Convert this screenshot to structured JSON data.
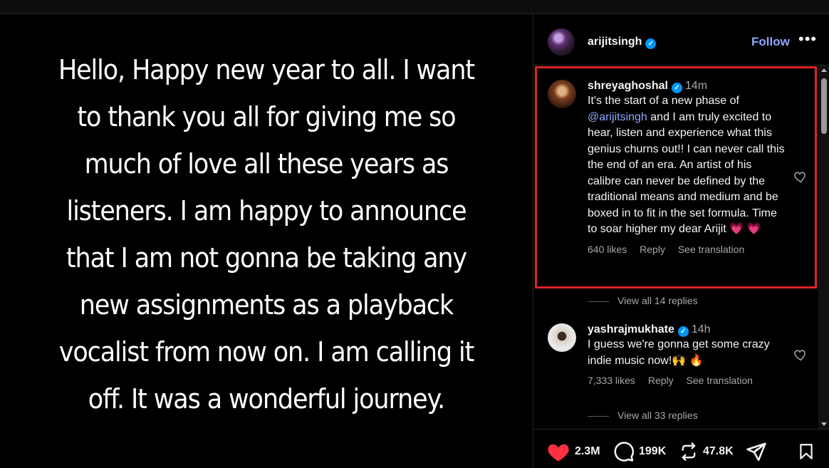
{
  "post": {
    "text": "Hello, Happy new year to all. I want to thank you all for giving me so much of love all these years as listeners. I am happy to announce that I am not gonna be taking any new assignments as a playback vocalist from now on. I am calling it off. It was a wonderful journey."
  },
  "header": {
    "username": "arijitsingh",
    "follow_label": "Follow",
    "more_label": "•••"
  },
  "comments": [
    {
      "username": "shreyaghoshal",
      "time": "14m",
      "text_before": "It's the start of a new phase of ",
      "mention": "@arijitsingh",
      "text_after": " and I am truly excited to hear, listen and experience what this genius churns out!! I can never call this the end of an era. An artist of his calibre can never be defined by the traditional means and medium and be boxed in to fit in the set formula. Time to soar higher my dear Arijit 💗 💗",
      "likes": "640 likes",
      "reply": "Reply",
      "translation": "See translation",
      "view_replies": "View all 14 replies"
    },
    {
      "username": "yashrajmukhate",
      "time": "14h",
      "text": "I guess we're gonna get some crazy indie music now!🙌 🔥",
      "likes": "7,333 likes",
      "reply": "Reply",
      "translation": "See translation",
      "view_replies": "View all 33 replies"
    }
  ],
  "actions": {
    "likes": "2.3M",
    "comments": "199K",
    "reposts": "47.8K"
  },
  "colors": {
    "accent_link": "#8fa8ff",
    "verified": "#0095f6",
    "highlight_border": "#e0222b",
    "like_red": "#ff3040"
  }
}
